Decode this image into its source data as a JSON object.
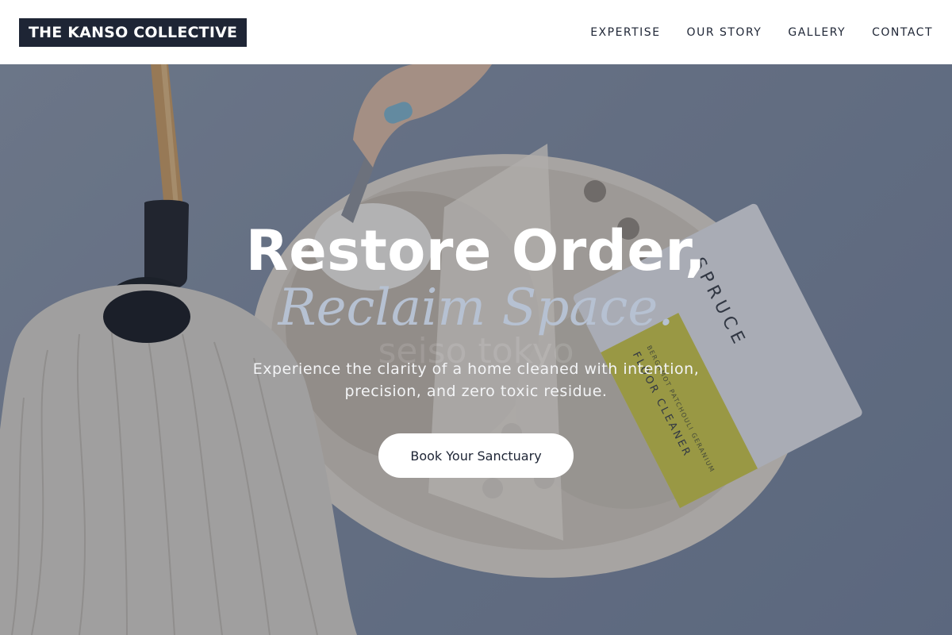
{
  "brand": {
    "name": "THE KANSO COLLECTIVE"
  },
  "nav": {
    "items": [
      {
        "label": "EXPERTISE"
      },
      {
        "label": "OUR STORY"
      },
      {
        "label": "GALLERY"
      },
      {
        "label": "CONTACT"
      }
    ]
  },
  "hero": {
    "headline": "Restore Order,",
    "subheadline": "Reclaim Space.",
    "watermark": "seiso tokyo",
    "lede": "Experience the clarity of a home cleaned with intention, precision, and zero toxic residue.",
    "cta_label": "Book Your Sanctuary",
    "product": {
      "brand": "SPRUCE",
      "name": "FLOOR CLEANER",
      "scent": "BERGAMOT PATCHOULI GERANIUM"
    }
  },
  "colors": {
    "header_bg": "#ffffff",
    "logo_bg": "#1e2535",
    "text_dark": "#1e2535",
    "accent_italic": "#b6c1d2",
    "hero_bg": "#7f8ba0"
  }
}
